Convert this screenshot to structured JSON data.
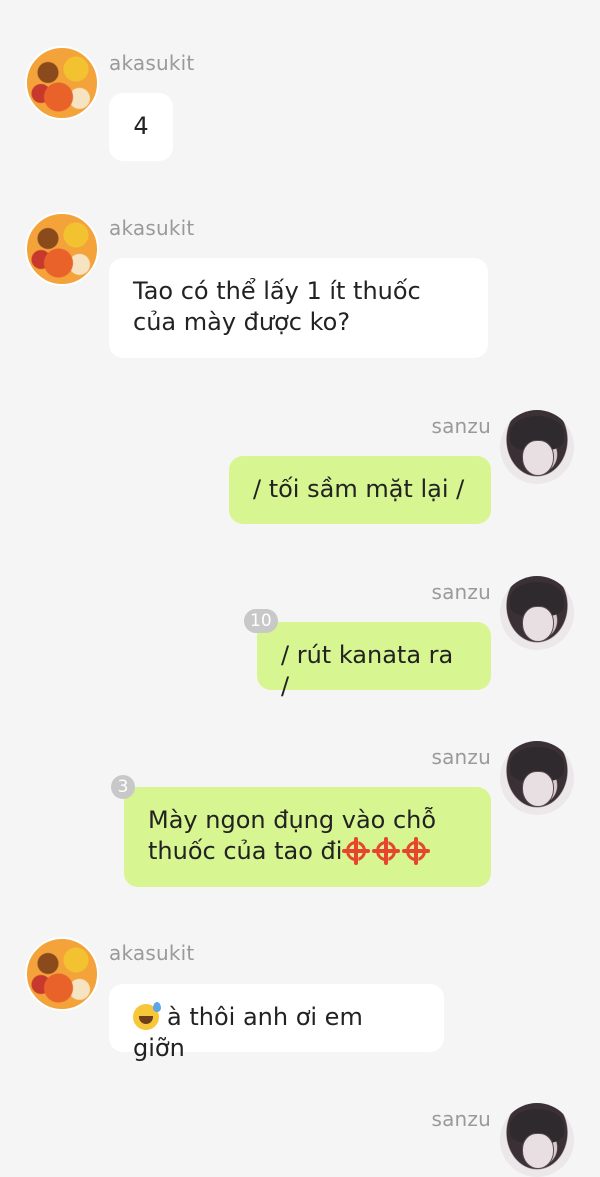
{
  "messages": [
    {
      "sender": "akasukit",
      "side": "left",
      "text": "4"
    },
    {
      "sender": "akasukit",
      "side": "left",
      "lines": [
        "Tao có thể lấy 1 ít thuốc",
        "của mày được ko?"
      ]
    },
    {
      "sender": "sanzu",
      "side": "right",
      "text": "/ tối sầm mặt lại /"
    },
    {
      "sender": "sanzu",
      "side": "right",
      "text": "/ rút kanata ra /",
      "badge": "10"
    },
    {
      "sender": "sanzu",
      "side": "right",
      "lines": [
        "Mày ngon đụng vào chỗ",
        "thuốc của tao đi"
      ],
      "badge": "3",
      "emoji": "anger-icon x3"
    },
    {
      "sender": "akasukit",
      "side": "left",
      "text": "à thôi anh ơi em giỡn",
      "emoji": "sweat-smile-icon"
    },
    {
      "sender": "sanzu",
      "side": "right"
    }
  ],
  "colors": {
    "background": "#f5f5f5",
    "incoming_bubble": "#ffffff",
    "outgoing_bubble": "#d7f590",
    "name": "#9a9a9a",
    "badge": "#c8c8c8"
  }
}
